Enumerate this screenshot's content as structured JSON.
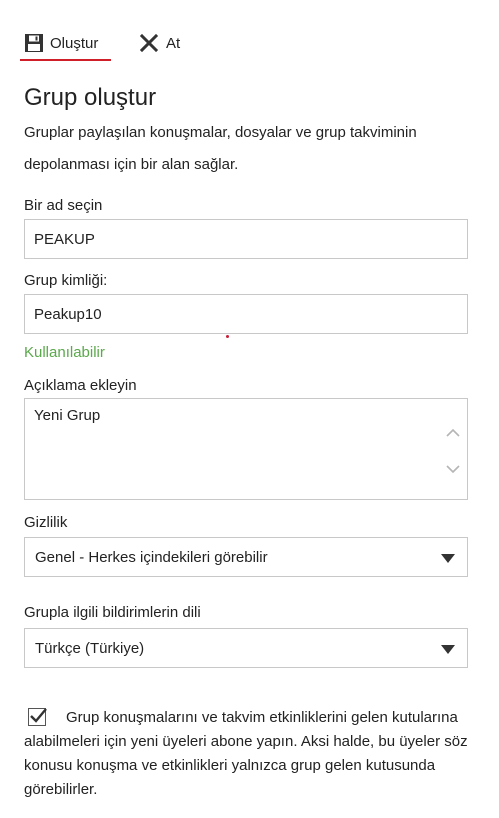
{
  "toolbar": {
    "save_label": "Oluştur",
    "discard_label": "At",
    "accent_color": "#d11f2a"
  },
  "page": {
    "title": "Grup oluştur",
    "description": "Gruplar paylaşılan konuşmalar, dosyalar ve grup takviminin depolanması için bir alan sağlar."
  },
  "name_field": {
    "label": "Bir ad seçin",
    "value": "PEAKUP"
  },
  "id_field": {
    "label": "Grup kimliği:",
    "value": "Peakup10",
    "status": "Kullanılabilir",
    "status_color": "#5aa94a"
  },
  "description_field": {
    "label": "Açıklama ekleyin",
    "value": "Yeni Grup"
  },
  "privacy": {
    "label": "Gizlilik",
    "selected": "Genel - Herkes içindekileri görebilir"
  },
  "language": {
    "label": "Grupla ilgili bildirimlerin dili",
    "selected": "Türkçe (Türkiye)"
  },
  "subscribe": {
    "checked": true,
    "text": "Grup konuşmalarını ve takvim etkinliklerini gelen kutularına alabilmeleri için yeni üyeleri abone yapın. Aksi halde, bu üyeler söz konusu konuşma ve etkinlikleri yalnızca grup gelen kutusunda görebilirler."
  },
  "icons": {
    "save": "floppy-disk-icon",
    "discard": "close-x-icon",
    "scroll_up": "chevron-up-icon",
    "scroll_down": "chevron-down-icon",
    "dropdown": "caret-down-icon",
    "check": "checkmark-icon"
  }
}
